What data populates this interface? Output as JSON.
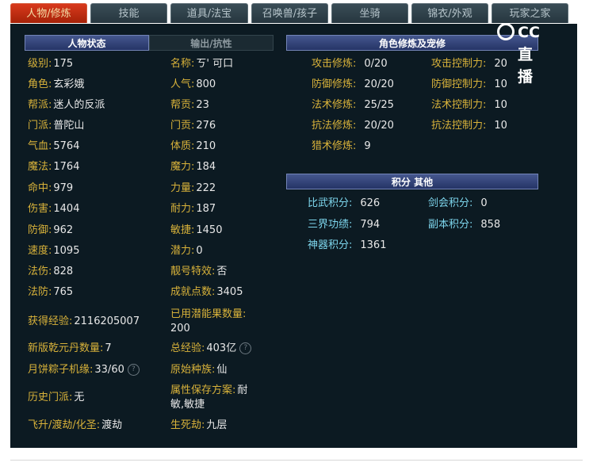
{
  "tabs": [
    {
      "label": "人物/修炼",
      "active": true
    },
    {
      "label": "技能",
      "active": false
    },
    {
      "label": "道具/法宝",
      "active": false
    },
    {
      "label": "召唤兽/孩子",
      "active": false
    },
    {
      "label": "坐骑",
      "active": false
    },
    {
      "label": "锦衣/外观",
      "active": false
    },
    {
      "label": "玩家之家",
      "active": false
    }
  ],
  "logo": {
    "text": "CC直播"
  },
  "headers": {
    "status": "人物状态",
    "output": "输出/抗性",
    "cultivation": "角色修炼及宠修",
    "points": "积分 其他"
  },
  "left_stats": [
    {
      "label": "级别:",
      "value": "175"
    },
    {
      "label": "角色:",
      "value": "玄彩娥"
    },
    {
      "label": "帮派:",
      "value": "迷人的反派"
    },
    {
      "label": "门派:",
      "value": "普陀山"
    },
    {
      "label": "气血:",
      "value": "5764"
    },
    {
      "label": "魔法:",
      "value": "1764"
    },
    {
      "label": "命中:",
      "value": "979"
    },
    {
      "label": "伤害:",
      "value": "1404"
    },
    {
      "label": "防御:",
      "value": "962"
    },
    {
      "label": "速度:",
      "value": "1095"
    },
    {
      "label": "法伤:",
      "value": "828"
    },
    {
      "label": "法防:",
      "value": "765"
    },
    {
      "label": "获得经验:",
      "value": "2116205007"
    },
    {
      "label": "新版乾元丹数量:",
      "value": "7"
    },
    {
      "label": "月饼粽子机缘:",
      "value": "33/60"
    },
    {
      "label": "历史门派:",
      "value": "无"
    },
    {
      "label": "飞升/渡劫/化圣:",
      "value": "渡劫"
    }
  ],
  "mid_stats": [
    {
      "label": "名称:",
      "value": "ㄎ' 可口"
    },
    {
      "label": "人气:",
      "value": "800"
    },
    {
      "label": "帮贡:",
      "value": "23"
    },
    {
      "label": "门贡:",
      "value": "276"
    },
    {
      "label": "体质:",
      "value": "210"
    },
    {
      "label": "魔力:",
      "value": "184"
    },
    {
      "label": "力量:",
      "value": "222"
    },
    {
      "label": "耐力:",
      "value": "187"
    },
    {
      "label": "敏捷:",
      "value": "1450"
    },
    {
      "label": "潜力:",
      "value": "0"
    },
    {
      "label": "靓号特效:",
      "value": "否"
    },
    {
      "label": "成就点数:",
      "value": "3405"
    },
    {
      "label": "已用潜能果数量:",
      "value": "200"
    },
    {
      "label": "总经验:",
      "value": "403亿"
    },
    {
      "label": "原始种族:",
      "value": "仙"
    },
    {
      "label": "属性保存方案:",
      "value": "耐",
      "value2": "敏,敏捷"
    },
    {
      "label": "生死劫:",
      "value": "九层"
    }
  ],
  "cultivation": [
    {
      "label": "攻击修炼:",
      "value": "0/20"
    },
    {
      "label": "防御修炼:",
      "value": "20/20"
    },
    {
      "label": "法术修炼:",
      "value": "25/25"
    },
    {
      "label": "抗法修炼:",
      "value": "20/20"
    },
    {
      "label": "猎术修炼:",
      "value": "9"
    }
  ],
  "control": [
    {
      "label": "攻击控制力:",
      "value": "20"
    },
    {
      "label": "防御控制力:",
      "value": "10"
    },
    {
      "label": "法术控制力:",
      "value": "10"
    },
    {
      "label": "抗法控制力:",
      "value": "10"
    }
  ],
  "points_left": [
    {
      "label": "比武积分:",
      "value": "626"
    },
    {
      "label": "三界功绩:",
      "value": "794"
    },
    {
      "label": "神器积分:",
      "value": "1361"
    }
  ],
  "points_right": [
    {
      "label": "剑会积分:",
      "value": "0"
    },
    {
      "label": "副本积分:",
      "value": "858"
    }
  ],
  "help_icon": "?"
}
